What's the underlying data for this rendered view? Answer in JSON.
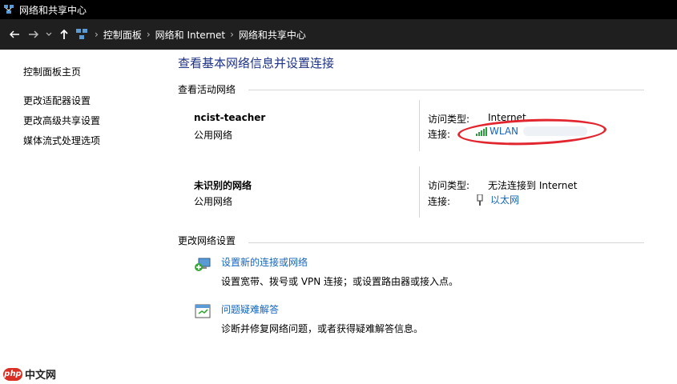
{
  "window": {
    "title": "网络和共享中心"
  },
  "nav": {
    "breadcrumbs": [
      "控制面板",
      "网络和 Internet",
      "网络和共享中心"
    ]
  },
  "sidebar": {
    "items": [
      {
        "label": "控制面板主页"
      },
      {
        "label": "更改适配器设置"
      },
      {
        "label": "更改高级共享设置"
      },
      {
        "label": "媒体流式处理选项"
      }
    ]
  },
  "main": {
    "title": "查看基本网络信息并设置连接",
    "active_networks_label": "查看活动网络",
    "networks": [
      {
        "name": "ncist-teacher",
        "type": "公用网络",
        "access_label": "访问类型:",
        "access_value": "Internet",
        "connection_label": "连接:",
        "connection_value": "WLAN",
        "connection_icon": "wifi-signal-icon"
      },
      {
        "name": "未识别的网络",
        "type": "公用网络",
        "access_label": "访问类型:",
        "access_value": "无法连接到 Internet",
        "connection_label": "连接:",
        "connection_value": "以太网",
        "connection_icon": "ethernet-icon"
      }
    ],
    "change_settings_label": "更改网络设置",
    "tasks": [
      {
        "link": "设置新的连接或网络",
        "description": "设置宽带、拨号或 VPN 连接；或设置路由器或接入点。",
        "icon": "new-connection-icon"
      },
      {
        "link": "问题疑难解答",
        "description": "诊断并修复网络问题，或者获得疑难解答信息。",
        "icon": "troubleshoot-icon"
      }
    ]
  },
  "annotation": {
    "color": "#e2262f"
  },
  "watermark": {
    "badge": "php",
    "text": "中文网"
  },
  "colors": {
    "link": "#1565c0",
    "title": "#1e3287",
    "titlebar": "#000000",
    "navbar": "#1f1f1f"
  }
}
